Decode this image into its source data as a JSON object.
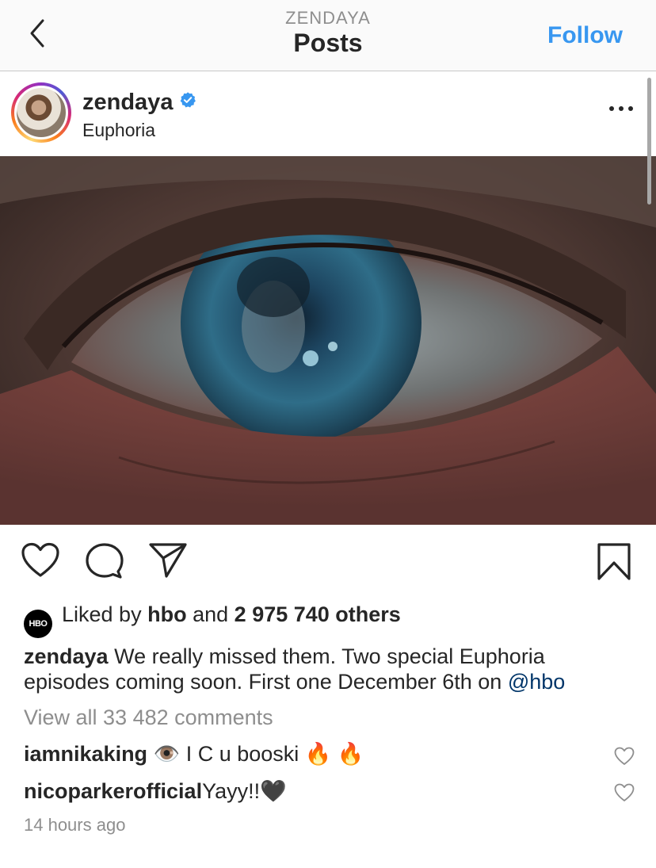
{
  "nav": {
    "account": "ZENDAYA",
    "title": "Posts",
    "follow_label": "Follow",
    "back_icon": "chevron-left-icon"
  },
  "post": {
    "username": "zendaya",
    "verified_icon": "verified-badge-icon",
    "location": "Euphoria",
    "more_icon": "more-horizontal-icon",
    "image_alt": "close-up of an eye reflecting a face"
  },
  "actions": {
    "like_icon": "heart-icon",
    "comment_icon": "comment-icon",
    "share_icon": "send-icon",
    "save_icon": "bookmark-icon"
  },
  "likes": {
    "badge": "HBO",
    "prefix": "Liked by",
    "user": "hbo",
    "connector": "and",
    "count": "2 975 740 others"
  },
  "caption": {
    "user": "zendaya",
    "text": "We really missed them. Two special Euphoria episodes coming soon. First one December 6th on",
    "mention": "@hbo"
  },
  "view_comments": "View all 33 482 comments",
  "comments": [
    {
      "user": "iamnikaking",
      "text": "👁️ I C u booski 🔥 🔥"
    },
    {
      "user": "nicoparkerofficial",
      "text": "Yayy!!🖤"
    }
  ],
  "timestamp": "14 hours ago",
  "colors": {
    "link_blue": "#3897f0",
    "mention_blue": "#003569",
    "muted_gray": "#8e8e8e",
    "text": "#262626",
    "verified_blue": "#3897f0"
  }
}
